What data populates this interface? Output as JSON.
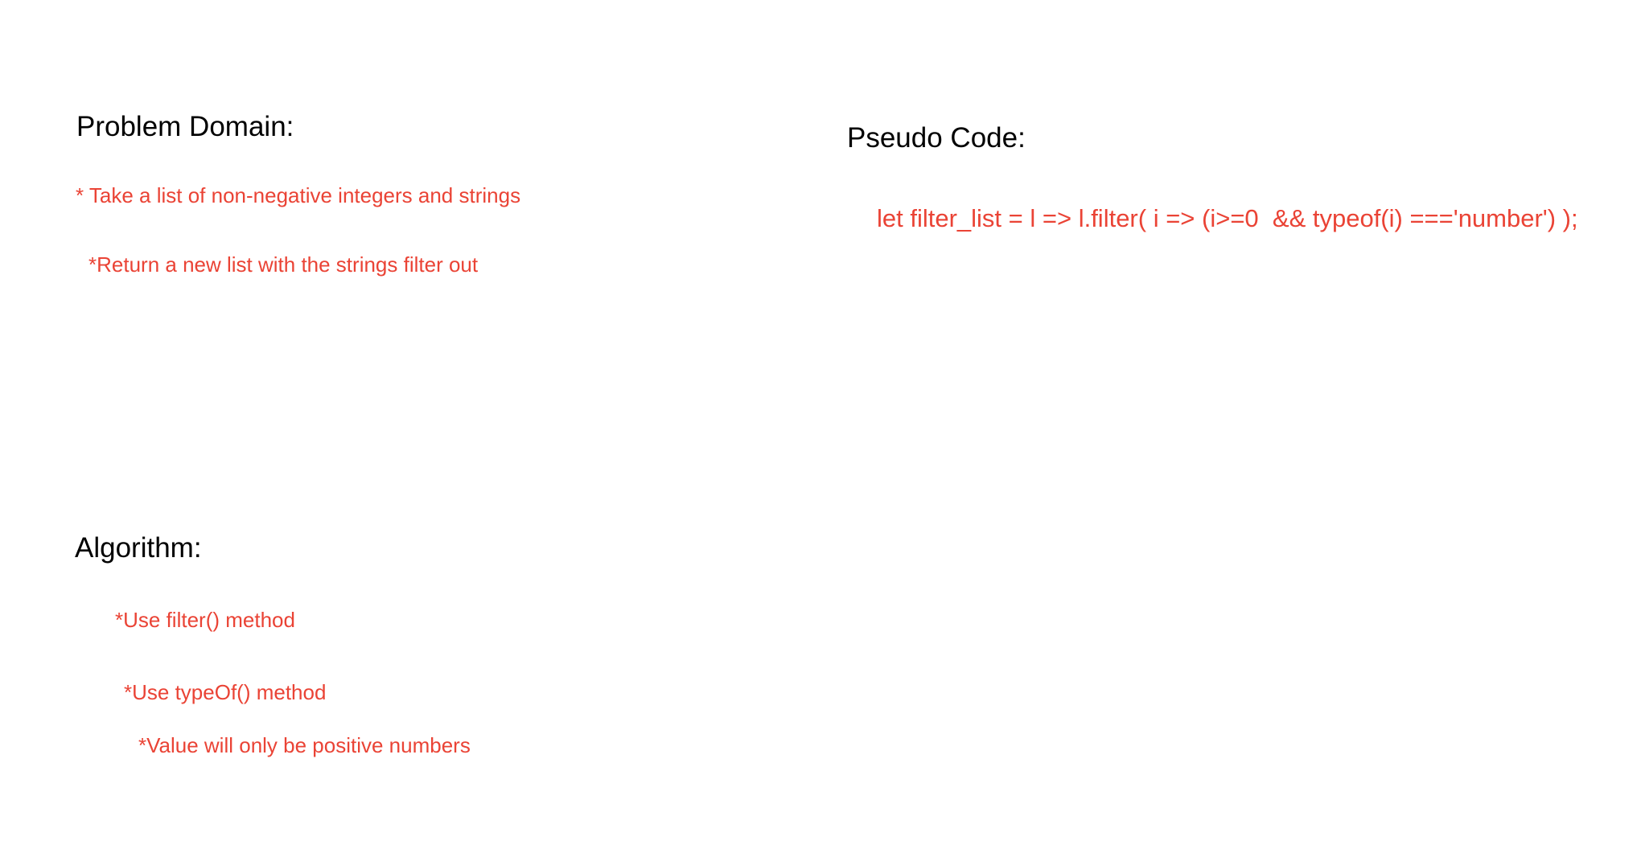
{
  "colors": {
    "heading": "#000000",
    "note": "#ea4335",
    "background": "#ffffff"
  },
  "problem_domain": {
    "title": "Problem Domain:",
    "items": [
      "* Take a list of non-negative integers and strings",
      "*Return a new list with the strings filter out"
    ]
  },
  "pseudo_code": {
    "title": "Pseudo Code:",
    "code": "let filter_list = l => l.filter( i => (i>=0  && typeof(i) ==='number') );"
  },
  "algorithm": {
    "title": "Algorithm:",
    "items": [
      "*Use filter() method",
      "*Use typeOf() method",
      "*Value will only be positive numbers"
    ]
  }
}
